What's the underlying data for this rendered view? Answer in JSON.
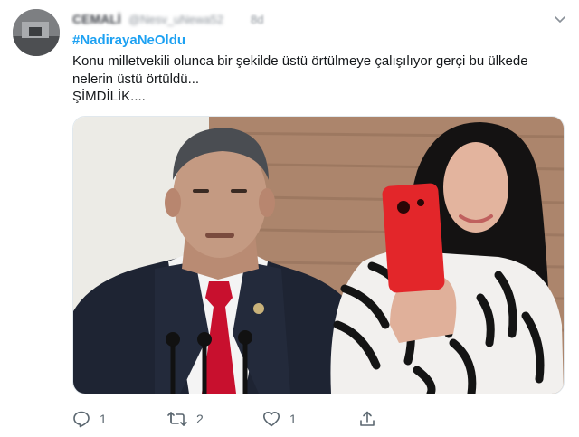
{
  "tweet": {
    "display_name": "CEMALİ",
    "handle": "@Nesv_uNewa52",
    "time": "8d",
    "hashtag": "#NadirayaNeOldu",
    "text_lines": [
      "Konu milletvekili olunca bir şekilde üstü örtülmeye çalışılıyor gerçi bu ülkede",
      "nelerin üstü örtüldü...",
      "ŞİMDİLİK...."
    ]
  },
  "actions": {
    "reply_icon": "reply-icon",
    "reply_count": "1",
    "retweet_icon": "retweet-icon",
    "retweet_count": "2",
    "like_icon": "heart-icon",
    "like_count": "1",
    "share_icon": "share-icon"
  },
  "colors": {
    "link": "#1da1f2",
    "text": "#14171a",
    "muted": "#5b6770",
    "tie_red": "#c8102e",
    "phone_red": "#e3262a"
  }
}
